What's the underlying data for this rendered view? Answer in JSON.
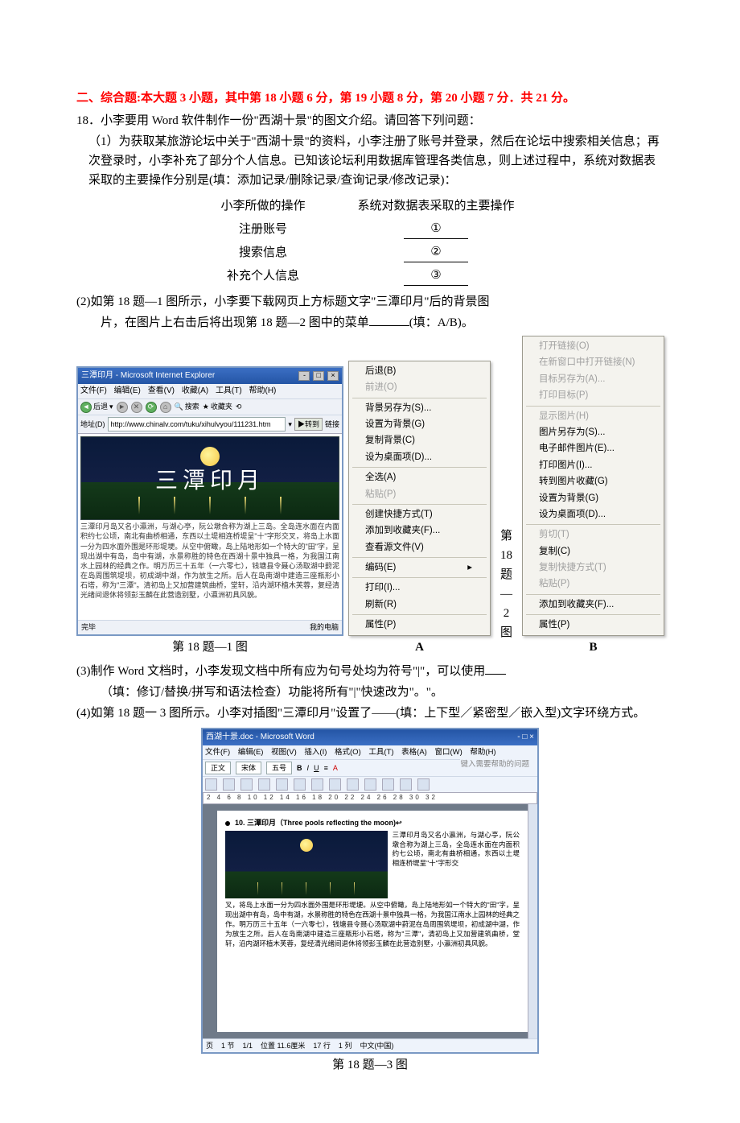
{
  "section_title": "二、综合题:本大题 3 小题，其中第 18 小题 6 分，第 19 小题 8 分，第 20 小题 7 分．共 21 分。",
  "q18_intro": "18．小李要用 Word 软件制作一份\"西湖十景\"的图文介绍。请回答下列问题：",
  "q18_1": "（1）为获取某旅游论坛中关于\"西湖十景\"的资料，小李注册了账号并登录，然后在论坛中搜索相关信息；再次登录时，小李补充了部分个人信息。已知该论坛利用数据库管理各类信息，则上述过程中，系统对数据表采取的主要操作分别是(填：添加记录/删除记录/查询记录/修改记录)：",
  "ops_header_left": "小李所做的操作",
  "ops_header_right": "系统对数据表采取的主要操作",
  "ops_rows": [
    {
      "left": "注册账号",
      "right": "①"
    },
    {
      "left": "搜索信息",
      "right": "②"
    },
    {
      "left": "补充个人信息",
      "right": "③"
    }
  ],
  "q18_2a": "(2)如第 18 题—1 图所示，小李要下载网页上方标题文字\"三潭印月\"后的背景图",
  "q18_2b_pre": "片，在图片上右击后将出现第 18 题—2 图中的菜单",
  "q18_2b_post": "(填：A/B)。",
  "ie": {
    "title": "三潭印月 - Microsoft Internet Explorer",
    "menus": [
      "文件(F)",
      "编辑(E)",
      "查看(V)",
      "收藏(A)",
      "工具(T)",
      "帮助(H)"
    ],
    "toolbar_back": "后退",
    "toolbar_search": "搜索",
    "toolbar_fav": "收藏夹",
    "addr_label": "地址(D)",
    "url": "http://www.chinalv.com/tuku/xihulvyou/111231.htm",
    "go": "转到",
    "link": "链接",
    "banner_title": "三潭印月",
    "body": "三潭印月岛又名小瀛洲，与湖心亭，阮公墩合称为湖上三岛。全岛连水面在内面积约七公顷，南北有曲桥相通，东西以土堤相连桥堤呈\"十\"字形交叉，将岛上水面一分为四水面外围是环形堤埂。从空中俯瞰，岛上陆地形如一个特大的\"田\"字，呈现出湖中有岛，岛中有湖，水景称胜的特色在西湖十景中独具一格，为我国江南水上园林的经典之作。明万历三十五年（一六零七），钱塘县令聂心汤取湖中葑泥在岛周围筑堤坝，初成湖中湖，作为放生之所。后人在岛南湖中建造三座瓶形小石塔，称为\"三潭\"。清初岛上又加营建筑曲桥，堂轩，沿内湖环植木芙蓉，复经清光绪间退休将领彭玉麟在此营造别墅，小瀛洲初具风貌。",
    "status_left": "完毕",
    "status_right": "我的电脑"
  },
  "fig1_caption": "第 18 题—1 图",
  "menuA": [
    {
      "t": "后退(B)",
      "d": false
    },
    {
      "t": "前进(O)",
      "d": true
    },
    "-",
    {
      "t": "背景另存为(S)...",
      "d": false
    },
    {
      "t": "设置为背景(G)",
      "d": false
    },
    {
      "t": "复制背景(C)",
      "d": false
    },
    {
      "t": "设为桌面项(D)...",
      "d": false
    },
    "-",
    {
      "t": "全选(A)",
      "d": false
    },
    {
      "t": "粘贴(P)",
      "d": true
    },
    "-",
    {
      "t": "创建快捷方式(T)",
      "d": false
    },
    {
      "t": "添加到收藏夹(F)...",
      "d": false
    },
    {
      "t": "查看源文件(V)",
      "d": false
    },
    "-",
    {
      "t": "编码(E)",
      "d": false,
      "sub": true
    },
    "-",
    {
      "t": "打印(I)...",
      "d": false
    },
    {
      "t": "刷新(R)",
      "d": false
    },
    "-",
    {
      "t": "属性(P)",
      "d": false
    }
  ],
  "menuB": [
    {
      "t": "打开链接(O)",
      "d": true
    },
    {
      "t": "在新窗口中打开链接(N)",
      "d": true
    },
    {
      "t": "目标另存为(A)...",
      "d": true
    },
    {
      "t": "打印目标(P)",
      "d": true
    },
    "-",
    {
      "t": "显示图片(H)",
      "d": true
    },
    {
      "t": "图片另存为(S)...",
      "d": false
    },
    {
      "t": "电子邮件图片(E)...",
      "d": false
    },
    {
      "t": "打印图片(I)...",
      "d": false
    },
    {
      "t": "转到图片收藏(G)",
      "d": false
    },
    {
      "t": "设置为背景(G)",
      "d": false
    },
    {
      "t": "设为桌面项(D)...",
      "d": false
    },
    "-",
    {
      "t": "剪切(T)",
      "d": true
    },
    {
      "t": "复制(C)",
      "d": false
    },
    {
      "t": "复制快捷方式(T)",
      "d": true
    },
    {
      "t": "粘贴(P)",
      "d": true
    },
    "-",
    {
      "t": "添加到收藏夹(F)...",
      "d": false
    },
    "-",
    {
      "t": "属性(P)",
      "d": false
    }
  ],
  "labelA": "A",
  "labelB": "B",
  "fig2_caption": "第 18 题—2 图",
  "q18_3a": "(3)制作 Word 文档时，小李发现文档中所有应为句号处均为符号\"|\"，可以使用",
  "q18_3b": "（填：修订/替换/拼写和语法检查）功能将所有\"|\"快速改为\"。\"。",
  "q18_4": "(4)如第 18 题一 3 图所示。小李对插图\"三潭印月\"设置了——(填：上下型／紧密型／嵌入型)文字环绕方式。",
  "word": {
    "title": "西湖十景.doc - Microsoft Word",
    "menus": [
      "文件(F)",
      "编辑(E)",
      "视图(V)",
      "插入(I)",
      "格式(O)",
      "工具(T)",
      "表格(A)",
      "窗口(W)",
      "帮助(H)"
    ],
    "hint": "键入需要帮助的问题",
    "style": "正文",
    "font": "宋体",
    "size": "五号",
    "ruler": "2  4  6  8  10  12  14  16  18  20  22  24  26  28  30  32",
    "heading": "10.  三潭印月（Three pools reflecting the moon)↩",
    "sidetext": "三潭印月岛又名小瀛洲，与湖心亭，阮公墩合称为湖上三岛，全岛连水面在内面积约七公顷，南北有曲桥相通，东西以土堤相连桥堤呈\"十\"字形交",
    "bodytext": "叉，将岛上水面一分为四水面外围是环形堤埂。从空中俯瞰，岛上陆地形如一个特大的\"田\"字，呈现出湖中有岛，岛中有湖，水景称胜的特色在西湖十景中独具一格，为我国江南水上园林的经典之作。明万历三十五年（一六零七），钱塘县令聂心汤取湖中葑泥在岛周围筑堤坝，初成湖中湖，作为放生之所。后人在岛南湖中建造三座瓶形小石塔，称为\"三潭\"，清初岛上又加营建筑曲桥，堂轩，沿内湖环植木芙蓉，复经清光绪间退休将领彭玉麟在此营造别墅，小瀛洲初具风貌。",
    "status": [
      "页",
      "1 节",
      "1/1",
      "位置 11.6厘米",
      "17 行",
      "1 列",
      "中文(中国)"
    ]
  },
  "fig3_caption": "第 18 题—3 图"
}
